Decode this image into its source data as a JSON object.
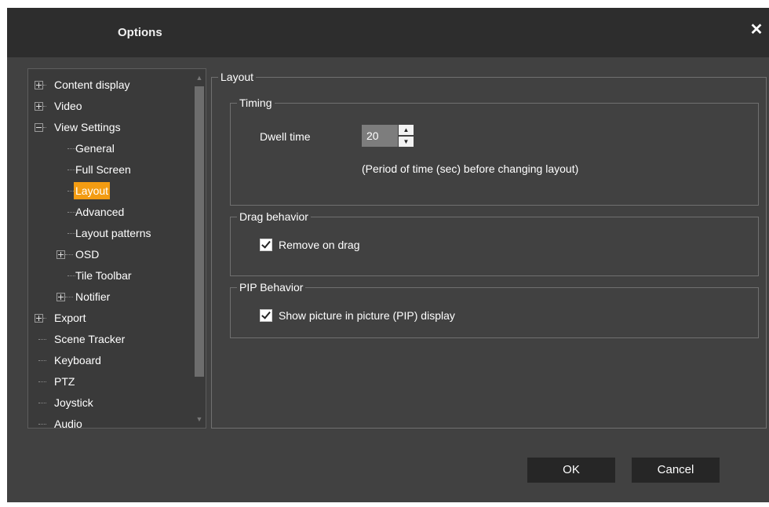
{
  "dialog": {
    "title": "Options",
    "close_label": "✕"
  },
  "tree": {
    "items": [
      {
        "label": "Content display",
        "expander": "plus"
      },
      {
        "label": "Video",
        "expander": "plus"
      },
      {
        "label": "View Settings",
        "expander": "minus"
      },
      {
        "label": "General"
      },
      {
        "label": "Full Screen"
      },
      {
        "label": "Layout",
        "selected": true
      },
      {
        "label": "Advanced"
      },
      {
        "label": "Layout patterns"
      },
      {
        "label": "OSD",
        "expander": "plus"
      },
      {
        "label": "Tile Toolbar"
      },
      {
        "label": "Notifier",
        "expander": "plus"
      },
      {
        "label": "Export",
        "expander": "plus"
      },
      {
        "label": "Scene Tracker"
      },
      {
        "label": "Keyboard"
      },
      {
        "label": "PTZ"
      },
      {
        "label": "Joystick"
      },
      {
        "label": "Audio"
      }
    ]
  },
  "layout_group": {
    "caption": "Layout",
    "timing": {
      "caption": "Timing",
      "dwell_label": "Dwell time",
      "dwell_value": "20",
      "hint": "(Period of time (sec) before changing layout)"
    },
    "drag": {
      "caption": "Drag behavior",
      "remove_on_drag_label": "Remove on drag",
      "remove_on_drag_checked": true
    },
    "pip": {
      "caption": "PIP Behavior",
      "show_pip_label": "Show picture in picture (PIP) display",
      "show_pip_checked": true
    }
  },
  "buttons": {
    "ok": "OK",
    "cancel": "Cancel"
  },
  "colors": {
    "selection": "#f39c12",
    "dialog_bg": "#414141",
    "titlebar_bg": "#2d2d2d",
    "button_bg": "#262626"
  }
}
